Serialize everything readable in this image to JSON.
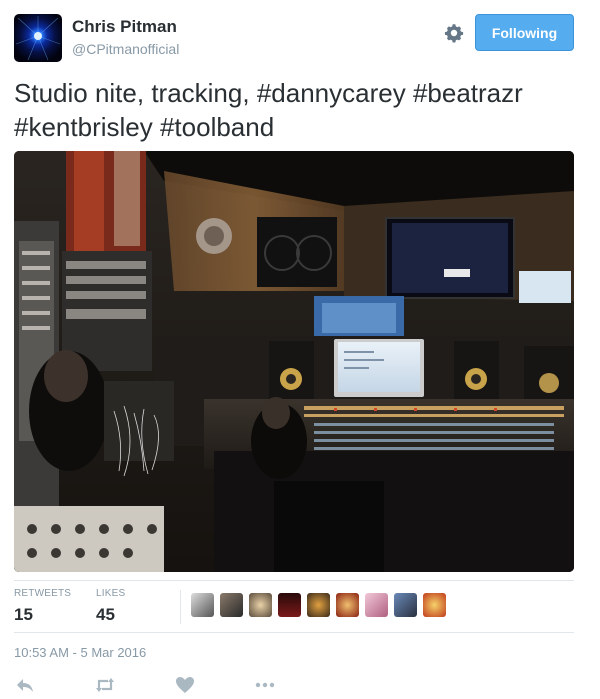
{
  "user": {
    "name": "Chris Pitman",
    "handle": "@CPitmanofficial"
  },
  "follow_button": {
    "label": "Following"
  },
  "tweet": {
    "line1": "Studio nite, tracking, ",
    "hashtags_line1": [
      "#dannycarey",
      "#beatrazr"
    ],
    "hashtags_line2": [
      "#kentbrisley",
      "#toolband"
    ]
  },
  "stats": {
    "retweets_label": "RETWEETS",
    "retweets_value": "15",
    "likes_label": "LIKES",
    "likes_value": "45"
  },
  "timestamp": "10:53 AM - 5 Mar 2016",
  "colors": {
    "accent": "#55acee",
    "text": "#292f33",
    "muted": "#8899a6",
    "action_icons": "#aab8c2"
  },
  "icons": [
    "gear-icon",
    "reply-icon",
    "retweet-icon",
    "like-icon",
    "more-icon"
  ]
}
